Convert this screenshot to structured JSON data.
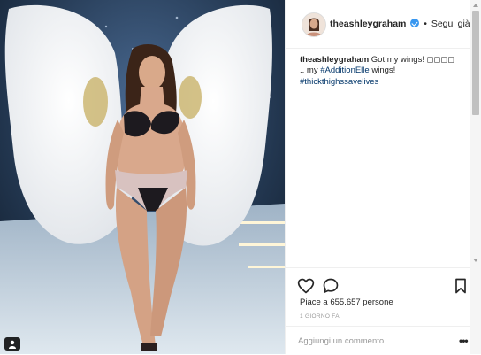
{
  "post": {
    "username": "theashleygraham",
    "verified": true,
    "separator": "•",
    "follow_label": "Segui già",
    "caption": {
      "username": "theashleygraham",
      "text_1": " Got my wings! ",
      "emojis": "◻◻◻◻",
      "text_2": ".. my ",
      "hashtag_1": "#AdditionElle",
      "text_3": " wings!",
      "hashtag_2": "#thickthighssavelives"
    },
    "likes_label": "Piace a 655.657 persone",
    "timestamp": "1 GIORNO FA",
    "comment_placeholder": "Aggiungi un commento...",
    "more_label": "•••"
  },
  "icons": {
    "like": "heart-icon",
    "comment": "comment-bubble-icon",
    "save": "bookmark-icon",
    "user_tag": "person-tag-icon",
    "verified": "verified-badge-icon"
  },
  "colors": {
    "link": "#003569",
    "verified": "#3897f0",
    "text": "#262626",
    "muted": "#999999",
    "divider": "#efefef"
  }
}
